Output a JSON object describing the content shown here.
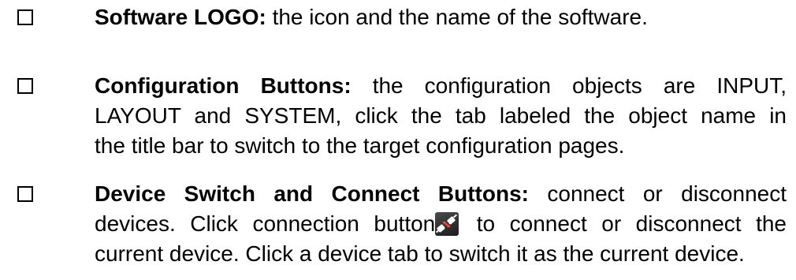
{
  "items": [
    {
      "term": "Software LOGO:",
      "desc": " the icon and the name of the software."
    },
    {
      "term": "Configuration Buttons:",
      "line1_rest": " the configuration objects are INPUT,",
      "line2": "LAYOUT and SYSTEM, click the tab labeled the object name in",
      "line3": "the title bar to switch to the target configuration pages."
    },
    {
      "term": "Device Switch and Connect Buttons:",
      "line1_rest": " connect or disconnect",
      "line2_before_icon": "devices. Click connection button",
      "icon": "connect-plug-icon",
      "line2_after_icon": " to connect or disconnect the",
      "line3": "current device. Click a device tab to switch it as the current device."
    }
  ]
}
